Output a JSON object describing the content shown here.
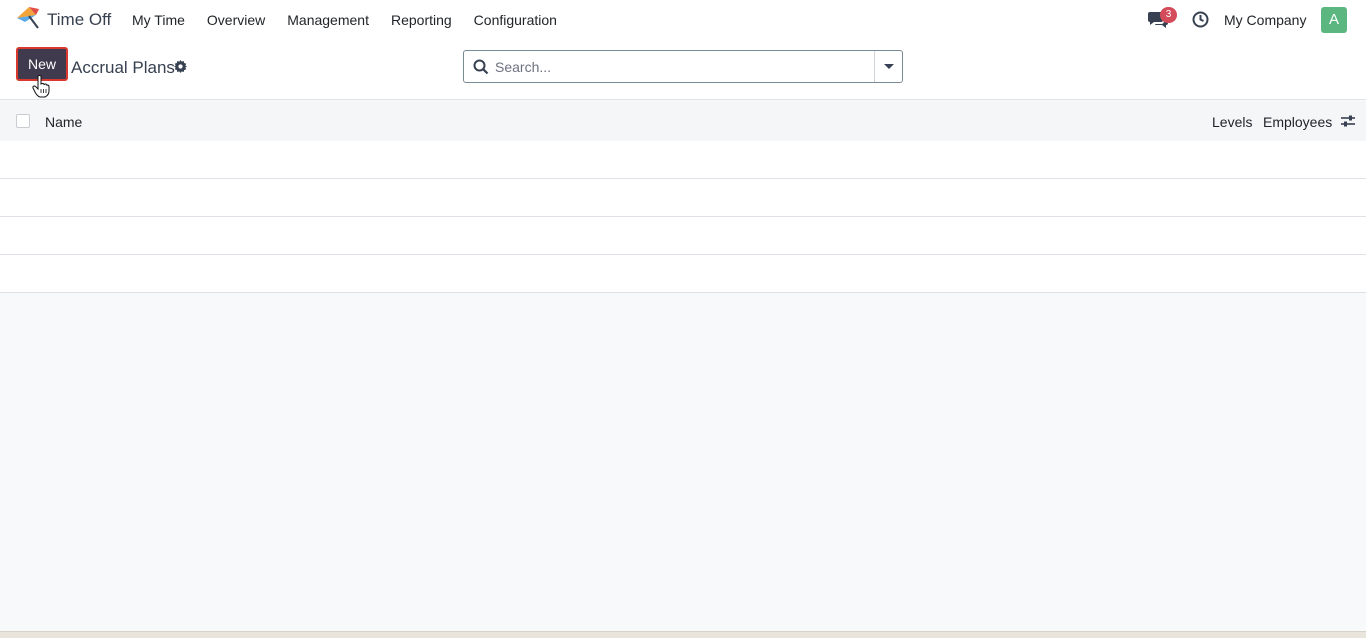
{
  "navbar": {
    "app_name": "Time Off",
    "menu": [
      "My Time",
      "Overview",
      "Management",
      "Reporting",
      "Configuration"
    ],
    "messages_badge": "3",
    "company": "My Company",
    "avatar_letter": "A"
  },
  "control_panel": {
    "new_label": "New",
    "title": "Accrual Plans",
    "search_placeholder": "Search..."
  },
  "list": {
    "columns": [
      "Name",
      "Levels",
      "Employees"
    ]
  },
  "colors": {
    "new_button_bg": "#3f3a4d",
    "highlight_border": "#d9382f",
    "avatar_bg": "#5cb67f",
    "badge_bg": "#d44c59"
  }
}
